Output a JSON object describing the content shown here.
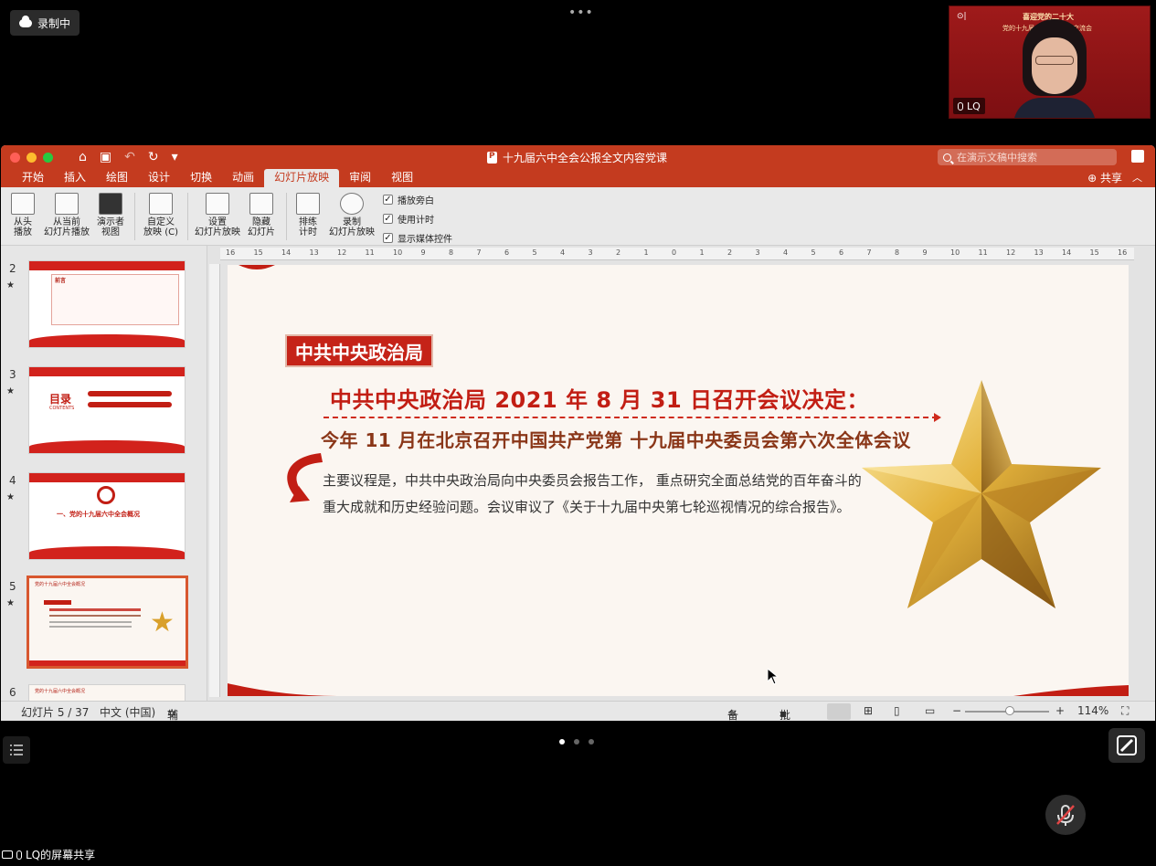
{
  "meeting": {
    "recording_label": "录制中",
    "more_dots": "•••",
    "participant_name": "LQ",
    "video_banner_line1": "喜迎党的二十大",
    "video_banner_line2": "党的十九届六中全会精神交流会",
    "share_label": "LQ的屏幕共享"
  },
  "window": {
    "title": "十九届六中全会公报全文内容党课",
    "search_placeholder": "在演示文稿中搜索"
  },
  "tabs": [
    "开始",
    "插入",
    "绘图",
    "设计",
    "切换",
    "动画",
    "幻灯片放映",
    "审阅",
    "视图"
  ],
  "active_tab": "幻灯片放映",
  "share_button": "共享",
  "ribbon": {
    "from_start": [
      "从头",
      "播放"
    ],
    "from_current": [
      "从当前",
      "幻灯片播放"
    ],
    "presenter": [
      "演示者",
      "视图"
    ],
    "custom": [
      "自定义",
      "放映 (C)"
    ],
    "setup": [
      "设置",
      "幻灯片放映"
    ],
    "hide": [
      "隐藏",
      "幻灯片"
    ],
    "rehearse": [
      "排练",
      "计时"
    ],
    "record": [
      "录制",
      "幻灯片放映"
    ],
    "checkboxes": [
      {
        "label": "播放旁白",
        "checked": true
      },
      {
        "label": "使用计时",
        "checked": true
      },
      {
        "label": "显示媒体控件",
        "checked": true
      }
    ]
  },
  "ruler_top": [
    "16",
    "15",
    "14",
    "13",
    "12",
    "11",
    "10",
    "9",
    "8",
    "7",
    "6",
    "5",
    "4",
    "3",
    "2",
    "1",
    "0",
    "1",
    "2",
    "3",
    "4",
    "5",
    "6",
    "7",
    "8",
    "9",
    "10",
    "11",
    "12",
    "13",
    "14",
    "15",
    "16"
  ],
  "thumbnails": [
    {
      "number": "2",
      "title": "前言",
      "selected": false
    },
    {
      "number": "3",
      "title": "目录",
      "subtitle": "CONTENTS",
      "selected": false
    },
    {
      "number": "4",
      "title": "一、党的十九届六中全会概况",
      "selected": false
    },
    {
      "number": "5",
      "title": "党的十九届六中全会概况",
      "selected": true
    },
    {
      "number": "6",
      "title": "党的十九届六中全会概况",
      "selected": false
    }
  ],
  "slide": {
    "tag": "中共中央政治局",
    "heading": "中共中央政治局 2021 年 8 月 31 日召开会议决定：",
    "subheading": "今年 11 月在北京召开中国共产党第 十九届中央委员会第六次全体会议",
    "body": "主要议程是，中共中央政治局向中央委员会报告工作， 重点研究全面总结党的百年奋斗的重大成就和历史经验问题。会议审议了《关于十九届中央第七轮巡视情况的综合报告》。"
  },
  "status": {
    "slide_count": "幻灯片 5 / 37",
    "language": "中文 (中国)",
    "accessibility": "辅助功能: 调查",
    "notes": "备注",
    "comments": "批注",
    "zoom_minus": "−",
    "zoom_plus": "+",
    "zoom_level": "114%"
  },
  "colors": {
    "ppt_accent": "#c43b1f",
    "slide_red": "#c21e14",
    "subheading_brown": "#8a3618",
    "star_gold": "#d9a02a"
  }
}
